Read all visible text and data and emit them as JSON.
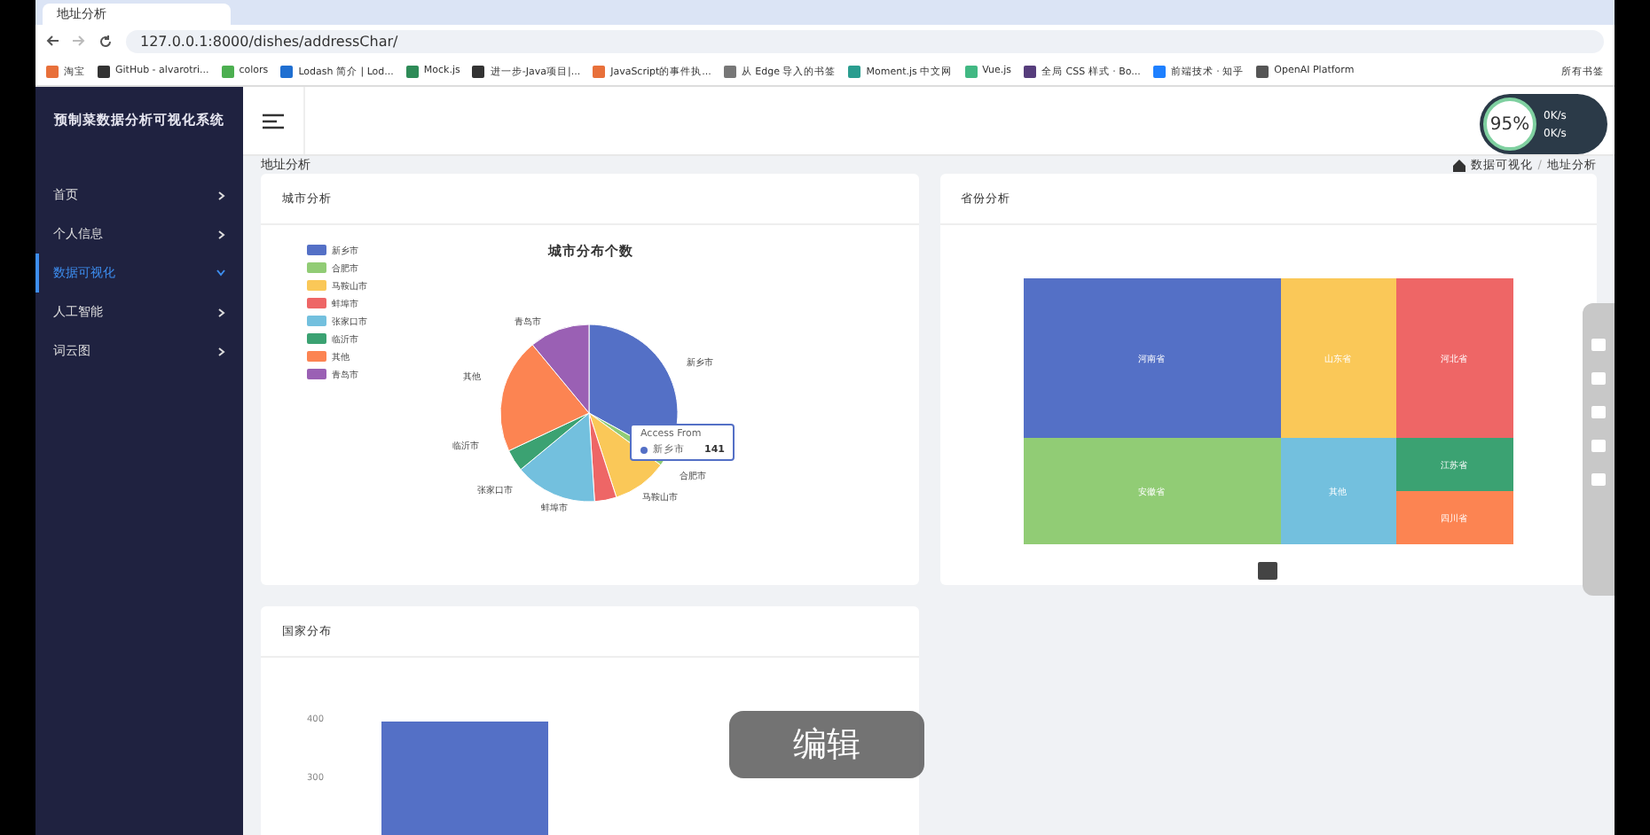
{
  "browser": {
    "tab_title": "地址分析",
    "url": "127.0.0.1:8000/dishes/addressChar/",
    "bookmarks": [
      "淘宝",
      "GitHub - alvarotri...",
      "colors",
      "Lodash 简介 | Lod...",
      "Mock.js",
      "进一步-Java项目|...",
      "JavaScript的事件执...",
      "从 Edge 导入的书签",
      "Moment.js 中文网",
      "Vue.js",
      "全局 CSS 样式 · Bo...",
      "前端技术 · 知乎",
      "OpenAI Platform"
    ],
    "all_bookmarks": "所有书签"
  },
  "sidebar": {
    "title": "预制菜数据分析可视化系统",
    "items": [
      {
        "label": "首页",
        "selected": false,
        "expanded": false
      },
      {
        "label": "个人信息",
        "selected": false,
        "expanded": false
      },
      {
        "label": "数据可视化",
        "selected": true,
        "expanded": true
      },
      {
        "label": "人工智能",
        "selected": false,
        "expanded": false
      },
      {
        "label": "词云图",
        "selected": false,
        "expanded": false
      }
    ]
  },
  "speed_widget": {
    "percent": "95%",
    "upload": "0K/s",
    "download": "0K/s"
  },
  "page_title": "地址分析",
  "breadcrumb": [
    "数据可视化",
    "/",
    "地址分析"
  ],
  "city_card": {
    "title": "城市分析",
    "chart_title": "城市分布个数",
    "legend": [
      {
        "label": "新乡市",
        "color": "#5470c6"
      },
      {
        "label": "合肥市",
        "color": "#91cc75"
      },
      {
        "label": "马鞍山市",
        "color": "#fac858"
      },
      {
        "label": "蚌埠市",
        "color": "#ee6666"
      },
      {
        "label": "张家口市",
        "color": "#73c0de"
      },
      {
        "label": "临沂市",
        "color": "#3ba272"
      },
      {
        "label": "其他",
        "color": "#fc8452"
      },
      {
        "label": "青岛市",
        "color": "#9a60b4"
      }
    ],
    "slice_labels": [
      "新乡市",
      "合肥市",
      "马鞍山市",
      "蚌埠市",
      "张家口市",
      "临沂市",
      "其他",
      "青岛市"
    ],
    "tooltip": {
      "title": "Access From",
      "name": "新乡市",
      "value": "141"
    }
  },
  "province_card": {
    "title": "省份分析",
    "tiles": [
      {
        "label": "河南省",
        "color": "#5470c6"
      },
      {
        "label": "山东省",
        "color": "#fac858"
      },
      {
        "label": "河北省",
        "color": "#ee6666"
      },
      {
        "label": "安徽省",
        "color": "#91cc75"
      },
      {
        "label": "其他",
        "color": "#73c0de"
      },
      {
        "label": "江苏省",
        "color": "#3ba272"
      },
      {
        "label": "四川省",
        "color": "#fc8452"
      }
    ]
  },
  "country_card": {
    "title": "国家分布",
    "y_ticks": [
      "400",
      "300"
    ]
  },
  "edit_overlay": "编辑"
}
